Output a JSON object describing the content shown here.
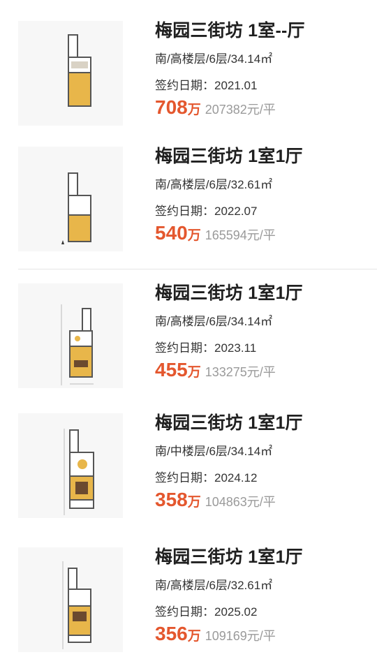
{
  "listings": [
    {
      "title": "梅园三街坊 1室--厅",
      "meta": "南/高楼层/6层/34.14㎡",
      "date": "签约日期：2021.01",
      "price": "708",
      "unit": "万",
      "per_sqm": "207382元/平"
    },
    {
      "title": "梅园三街坊 1室1厅",
      "meta": "南/高楼层/6层/32.61㎡",
      "date": "签约日期：2022.07",
      "price": "540",
      "unit": "万",
      "per_sqm": "165594元/平"
    },
    {
      "title": "梅园三街坊 1室1厅",
      "meta": "南/高楼层/6层/34.14㎡",
      "date": "签约日期：2023.11",
      "price": "455",
      "unit": "万",
      "per_sqm": "133275元/平"
    },
    {
      "title": "梅园三街坊 1室1厅",
      "meta": "南/中楼层/6层/34.14㎡",
      "date": "签约日期：2024.12",
      "price": "358",
      "unit": "万",
      "per_sqm": "104863元/平"
    },
    {
      "title": "梅园三街坊 1室1厅",
      "meta": "南/高楼层/6层/32.61㎡",
      "date": "签约日期：2025.02",
      "price": "356",
      "unit": "万",
      "per_sqm": "109169元/平"
    }
  ]
}
